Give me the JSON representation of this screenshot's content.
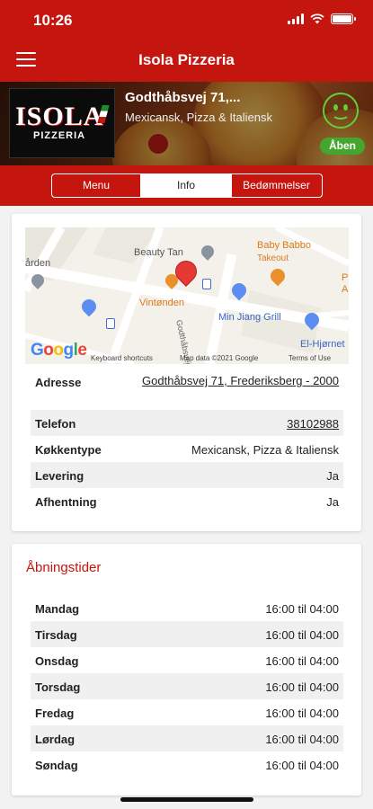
{
  "status_bar": {
    "time": "10:26"
  },
  "header": {
    "title": "Isola Pizzeria",
    "menu_icon": "hamburger-menu-icon"
  },
  "restaurant": {
    "logo_text": "ISOLA",
    "logo_subtext": "PIZZERIA",
    "name": "Godthåbsvej 71,...",
    "cuisine": "Mexicansk, Pizza & Italiensk",
    "rating_icon": "smiley-happy-icon",
    "status": "Åben",
    "colors": {
      "smiley": "#5fd13a",
      "status_badge": "#44a62e"
    }
  },
  "tabs": [
    {
      "label": "Menu",
      "active": false
    },
    {
      "label": "Info",
      "active": true
    },
    {
      "label": "Bedømmelser",
      "active": false
    }
  ],
  "map": {
    "labels": {
      "beauty": "Beauty Tan",
      "baby1": "Baby Babbo",
      "baby2": "Takeout",
      "arden": "ården",
      "vint": "Vintønden",
      "road": "Godthåbsvej",
      "jiang": "Min Jiang Grill",
      "hjornet": "El-Hjørnet",
      "edge_p": "P",
      "edge_a": "A"
    },
    "google": "Google",
    "shortcuts": "Keyboard shortcuts",
    "map_data": "Map data ©2021 Google",
    "terms": "Terms of Use"
  },
  "info": {
    "rows": [
      {
        "label": "Adresse",
        "value": "Godthåbsvej 71, Frederiksberg - 2000",
        "link": true
      },
      {
        "label": "Telefon",
        "value": "38102988",
        "link": true
      },
      {
        "label": "Køkkentype",
        "value": "Mexicansk, Pizza & Italiensk",
        "link": false
      },
      {
        "label": "Levering",
        "value": "Ja",
        "link": false
      },
      {
        "label": "Afhentning",
        "value": "Ja",
        "link": false
      }
    ]
  },
  "hours": {
    "title": "Åbningstider",
    "days": [
      {
        "day": "Mandag",
        "time": "16:00 til 04:00"
      },
      {
        "day": "Tirsdag",
        "time": "16:00 til 04:00"
      },
      {
        "day": "Onsdag",
        "time": "16:00 til 04:00"
      },
      {
        "day": "Torsdag",
        "time": "16:00 til 04:00"
      },
      {
        "day": "Fredag",
        "time": "16:00 til 04:00"
      },
      {
        "day": "Lørdag",
        "time": "16:00 til 04:00"
      },
      {
        "day": "Søndag",
        "time": "16:00 til 04:00"
      }
    ]
  },
  "theme": {
    "primary": "#c4150f",
    "row_shade": "#f0f0f0"
  }
}
